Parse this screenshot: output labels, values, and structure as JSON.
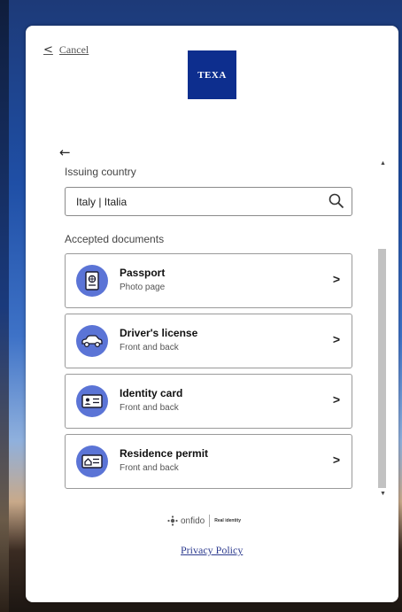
{
  "header": {
    "cancel_label": "Cancel",
    "logo_text": "TEXA"
  },
  "country": {
    "label": "Issuing country",
    "value": "Italy | Italia"
  },
  "documents": {
    "label": "Accepted documents",
    "items": [
      {
        "title": "Passport",
        "subtitle": "Photo page",
        "icon": "passport-icon"
      },
      {
        "title": "Driver's license",
        "subtitle": "Front and back",
        "icon": "car-icon"
      },
      {
        "title": "Identity card",
        "subtitle": "Front and back",
        "icon": "id-card-icon"
      },
      {
        "title": "Residence permit",
        "subtitle": "Front and back",
        "icon": "residence-permit-icon"
      }
    ]
  },
  "footer": {
    "brand": "onfido",
    "tagline": "Real identity",
    "privacy_label": "Privacy Policy"
  },
  "colors": {
    "logo_bg": "#0d2e8e",
    "icon_circle": "#5b74d6",
    "link": "#2d3b8f"
  }
}
